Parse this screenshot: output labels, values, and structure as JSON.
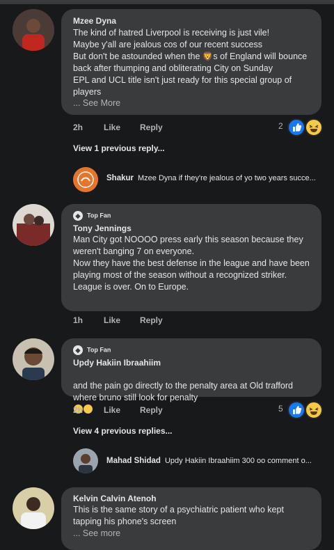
{
  "comments": [
    {
      "author": "Mzee Dyna",
      "lines": "The kind of hatred Liverpool is receiving is just vile!\nMaybe y'all are jealous cos of our recent success\nBut don't be astounded when the 🦁s of England will bounce back after thumping and obliterating City on Sunday\nEPL and UCL title isn't just ready for this special group of players",
      "see_more": "... See More",
      "time": "2h",
      "like": "Like",
      "reply": "Reply",
      "reaction_count": "2",
      "view_replies": "View 1 previous reply...",
      "last_reply": {
        "author": "Shakur",
        "text": "Mzee Dyna if they're jealous of yo two years succe..."
      }
    },
    {
      "badge": "Top Fan",
      "author": "Tony Jennings",
      "lines": "Man City got NOOOO press early this season because they weren't banging 7 on everyone.\nNow they have the best defense in the league and have been playing most of the season without a recognized striker.\nLeague is over. On to Europe.",
      "time": "1h",
      "like": "Like",
      "reply": "Reply"
    },
    {
      "badge": "Top Fan",
      "author": "Updy Hakiin Ibraahiim",
      "lines": "and the pain go directly to the penalty area at Old trafford where bruno still look for penalty",
      "time": "2h",
      "like": "Like",
      "reply": "Reply",
      "reaction_count": "5",
      "view_replies": "View 4 previous replies...",
      "last_reply": {
        "author": "Mahad Shidad",
        "text": "Updy Hakiin Ibraahiim  300 oo comment o..."
      }
    },
    {
      "author": "Kelvin Calvin Atenoh",
      "lines": "This is the same story of a psychiatric patient who kept tapping his phone's screen",
      "see_more": "... See more"
    }
  ],
  "colors": {
    "background": "#18191a",
    "bubble": "#3a3b3c",
    "like_blue": "#1877f2",
    "haha_yellow": "#f7c948"
  }
}
